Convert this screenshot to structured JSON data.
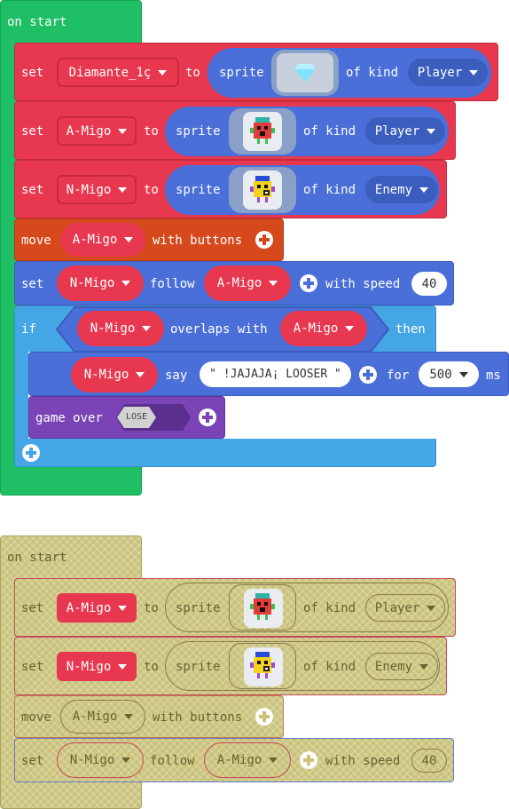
{
  "colors": {
    "event": "#1fbf65",
    "set": "#e8384f",
    "sprites": "#4a6fd8",
    "controller": "#d6491c",
    "logic": "#45a6e6",
    "game": "#7a43b6",
    "disabled": "#c9c27a"
  },
  "top": {
    "hat_label": "on start",
    "row1": {
      "set": "set",
      "variable": "Diamante_1ç",
      "to": "to",
      "sprite": "sprite",
      "of_kind": "of kind",
      "kind": "Player"
    },
    "row2": {
      "set": "set",
      "variable": "A-Migo",
      "to": "to",
      "sprite": "sprite",
      "of_kind": "of kind",
      "kind": "Player"
    },
    "row3": {
      "set": "set",
      "variable": "N-Migo",
      "to": "to",
      "sprite": "sprite",
      "of_kind": "of kind",
      "kind": "Enemy"
    },
    "move": {
      "label": "move",
      "variable": "A-Migo",
      "with_buttons": "with buttons"
    },
    "follow": {
      "set": "set",
      "variable": "N-Migo",
      "follow": "follow",
      "target": "A-Migo",
      "with_speed": "with speed",
      "speed": "40"
    },
    "if": {
      "if": "if",
      "left": "N-Migo",
      "overlaps": "overlaps with",
      "right": "A-Migo",
      "then": "then"
    },
    "say": {
      "variable": "N-Migo",
      "say": "say",
      "text": "\" !JAJAJA¡ LOOSER \"",
      "for": "for",
      "duration": "500",
      "ms": "ms"
    },
    "gameover": {
      "label": "game over",
      "value": "LOSE"
    }
  },
  "bottom": {
    "hat_label": "on start",
    "row1": {
      "set": "set",
      "variable": "A-Migo",
      "to": "to",
      "sprite": "sprite",
      "of_kind": "of kind",
      "kind": "Player"
    },
    "row2": {
      "set": "set",
      "variable": "N-Migo",
      "to": "to",
      "sprite": "sprite",
      "of_kind": "of kind",
      "kind": "Enemy"
    },
    "move": {
      "label": "move",
      "variable": "A-Migo",
      "with_buttons": "with buttons"
    },
    "follow": {
      "set": "set",
      "variable": "N-Migo",
      "follow": "follow",
      "target": "A-Migo",
      "with_speed": "with speed",
      "speed": "40"
    }
  }
}
